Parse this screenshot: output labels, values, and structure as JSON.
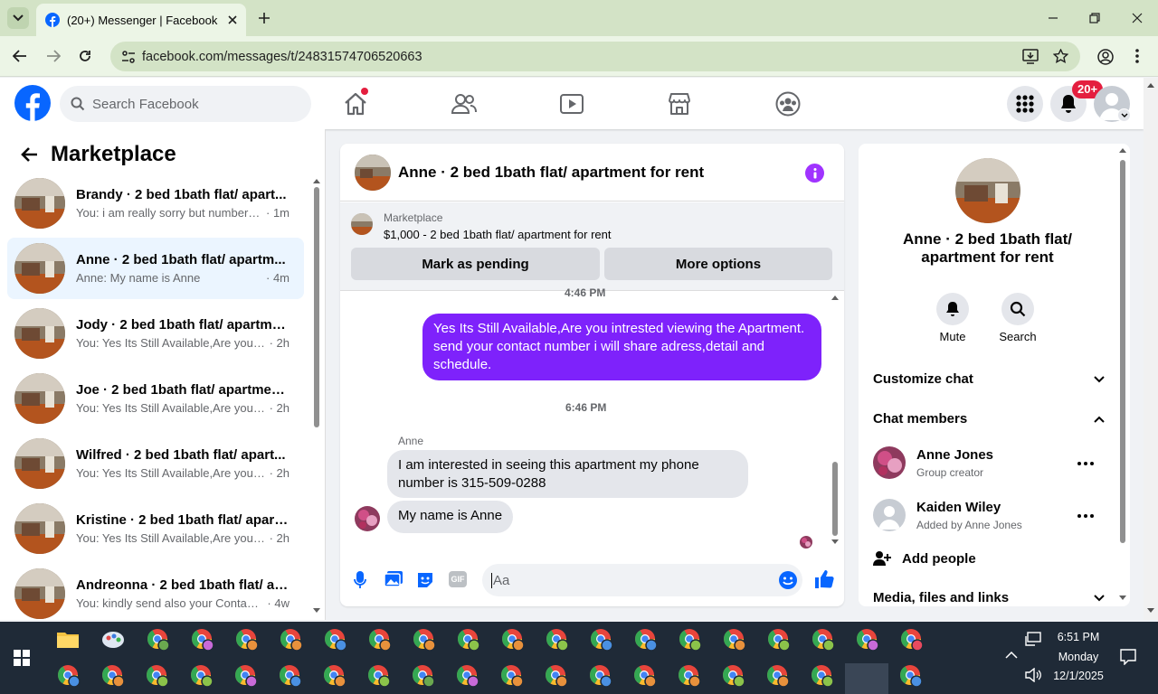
{
  "browser": {
    "tab_title": "(20+) Messenger | Facebook",
    "url": "facebook.com/messages/t/24831574706520663"
  },
  "fb": {
    "search_placeholder": "Search Facebook",
    "notifications_badge": "20+"
  },
  "left": {
    "title": "Marketplace",
    "conversations": [
      {
        "name": "Brandy · 2 bed 1bath flat/ apart...",
        "preview": "You: i am really sorry but number a...",
        "time": "1m",
        "selected": false
      },
      {
        "name": "Anne · 2 bed 1bath flat/ apartm...",
        "preview": "Anne: My name is Anne",
        "time": "4m",
        "selected": true
      },
      {
        "name": "Jody · 2 bed 1bath flat/ apartme...",
        "preview": "You: Yes Its Still Available,Are you in...",
        "time": "2h",
        "selected": false
      },
      {
        "name": "Joe · 2 bed 1bath flat/ apartmen...",
        "preview": "You: Yes Its Still Available,Are you in...",
        "time": "2h",
        "selected": false
      },
      {
        "name": "Wilfred · 2 bed 1bath flat/ apart...",
        "preview": "You: Yes Its Still Available,Are you in...",
        "time": "2h",
        "selected": false
      },
      {
        "name": "Kristine · 2 bed 1bath flat/ apart...",
        "preview": "You: Yes Its Still Available,Are you in...",
        "time": "2h",
        "selected": false
      },
      {
        "name": "Andreonna · 2 bed 1bath flat/ ap...",
        "preview": "You: kindly send also your Contact ...",
        "time": "4w",
        "selected": false
      }
    ]
  },
  "chat": {
    "title": "Anne · 2 bed 1bath flat/ apartment for rent",
    "marketplace_label": "Marketplace",
    "listing": "$1,000 - 2 bed 1bath flat/ apartment for rent",
    "mark_pending": "Mark as pending",
    "more_options": "More options",
    "time_top": "4:46 PM",
    "my_message": "Yes Its Still Available,Are you intrested viewing the Apartment. send your contact number i will share adress,detail and schedule.",
    "time_mid": "6:46 PM",
    "sender": "Anne",
    "their_message_1": "I am interested in seeing this apartment my phone number is 315-509-0288",
    "their_message_2": "My name is Anne",
    "composer_placeholder": "Aa"
  },
  "right": {
    "title": "Anne · 2 bed 1bath flat/ apartment for rent",
    "mute": "Mute",
    "search": "Search",
    "customize": "Customize chat",
    "members": "Chat members",
    "member1_name": "Anne Jones",
    "member1_role": "Group creator",
    "member2_name": "Kaiden Wiley",
    "member2_role": "Added by Anne Jones",
    "add_people": "Add people",
    "media": "Media, files and links"
  },
  "taskbar": {
    "time": "6:51 PM",
    "day": "Monday",
    "date": "12/1/2025"
  },
  "colors": {
    "fb_blue": "#0866ff",
    "messenger_purple": "#7e22fb",
    "badge_red": "#e41e3f"
  }
}
